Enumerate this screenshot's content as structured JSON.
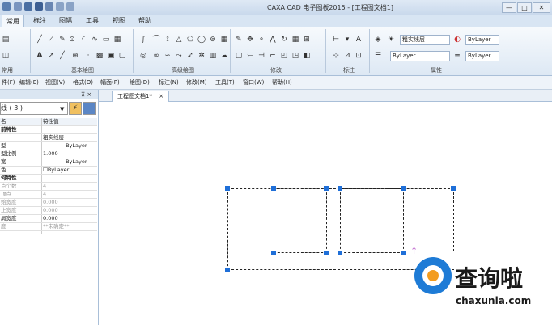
{
  "title_bar": {
    "title": "CAXA CAD 电子图板2015 - [工程图文档1]",
    "minimize": "—",
    "maximize": "□",
    "close": "✕"
  },
  "ribbon_tabs": [
    {
      "label": "常用",
      "active": true
    },
    {
      "label": "标注"
    },
    {
      "label": "图幅"
    },
    {
      "label": "工具"
    },
    {
      "label": "视图"
    },
    {
      "label": "帮助"
    }
  ],
  "ribbon_groups": {
    "basic_draw": "基本绘图",
    "advanced_draw": "高级绘图",
    "modify": "修改",
    "annotate": "标注",
    "properties": "属性",
    "common": "常用"
  },
  "ribbon_props": {
    "layer": "粗实线层",
    "linetype": "ByLayer",
    "color": "ByLayer",
    "lineweight": "ByLayer"
  },
  "menu_items": [
    "件(F)",
    "编辑(E)",
    "视图(V)",
    "格式(O)",
    "幅面(P)",
    "绘图(D)",
    "标注(N)",
    "修改(M)",
    "工具(T)",
    "窗口(W)",
    "帮助(H)"
  ],
  "panel": {
    "header_pin": "⊼ ×",
    "combo_value": "线 ( 3 )",
    "col_name": "名",
    "col_value": "特性值",
    "rows": [
      {
        "name": "前特性",
        "value": "",
        "section": true
      },
      {
        "name": "",
        "value": "粗实线层"
      },
      {
        "name": "型",
        "value": "———— ByLayer"
      },
      {
        "name": "型比例",
        "value": "1.000"
      },
      {
        "name": "宽",
        "value": "———— ByLayer"
      },
      {
        "name": "色",
        "value": "☐ByLayer"
      },
      {
        "name": "何特性",
        "value": "",
        "section": true
      },
      {
        "name": "点个数",
        "value": "4",
        "dim": true
      },
      {
        "name": "顶点",
        "value": "4",
        "dim": true
      },
      {
        "name": "始宽度",
        "value": "0.000",
        "dim": true
      },
      {
        "name": "止宽度",
        "value": "0.000",
        "dim": true
      },
      {
        "name": "局宽度",
        "value": "0.000"
      },
      {
        "name": "度",
        "value": "**未确定**",
        "dim": true
      }
    ]
  },
  "doc_tab": {
    "label": "工程图文档1*",
    "close": "×"
  },
  "watermark": {
    "text": "查询啦",
    "url": "chaxunla.com"
  }
}
